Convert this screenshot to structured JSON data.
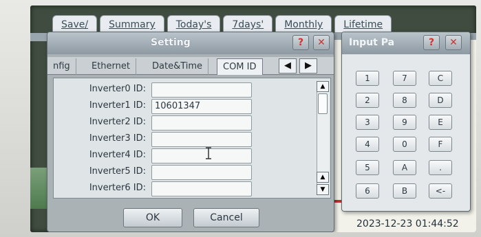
{
  "background": {
    "tabs": [
      "Save/",
      "Summary",
      "Today's",
      "7days'",
      "Monthly",
      "Lifetime"
    ],
    "datetime": "2023-12-23 01:44:52"
  },
  "dialog": {
    "title": "Setting",
    "help_label": "?",
    "close_label": "✕",
    "tabs": [
      "nfig",
      "Ethernet",
      "Date&Time",
      "COM ID"
    ],
    "arrow_left": "◀",
    "arrow_right": "▶",
    "rows": [
      {
        "label": "Inverter0 ID:",
        "value": ""
      },
      {
        "label": "Inverter1 ID:",
        "value": "10601347"
      },
      {
        "label": "Inverter2 ID:",
        "value": ""
      },
      {
        "label": "Inverter3 ID:",
        "value": ""
      },
      {
        "label": "Inverter4 ID:",
        "value": ""
      },
      {
        "label": "Inverter5 ID:",
        "value": ""
      },
      {
        "label": "Inverter6 ID:",
        "value": ""
      }
    ],
    "ok_label": "OK",
    "cancel_label": "Cancel"
  },
  "keypad": {
    "title": "Input Pa",
    "help_label": "?",
    "close_label": "✕",
    "keys": [
      [
        "1",
        "7",
        "C"
      ],
      [
        "2",
        "8",
        "D"
      ],
      [
        "3",
        "9",
        "E"
      ],
      [
        "4",
        "0",
        "F"
      ],
      [
        "5",
        "A",
        "."
      ],
      [
        "6",
        "B",
        "<-"
      ]
    ]
  },
  "colors": {
    "title_bar": "#8e9aa3",
    "close_accent": "#cc3333",
    "field_bg": "#f6f7f7"
  }
}
